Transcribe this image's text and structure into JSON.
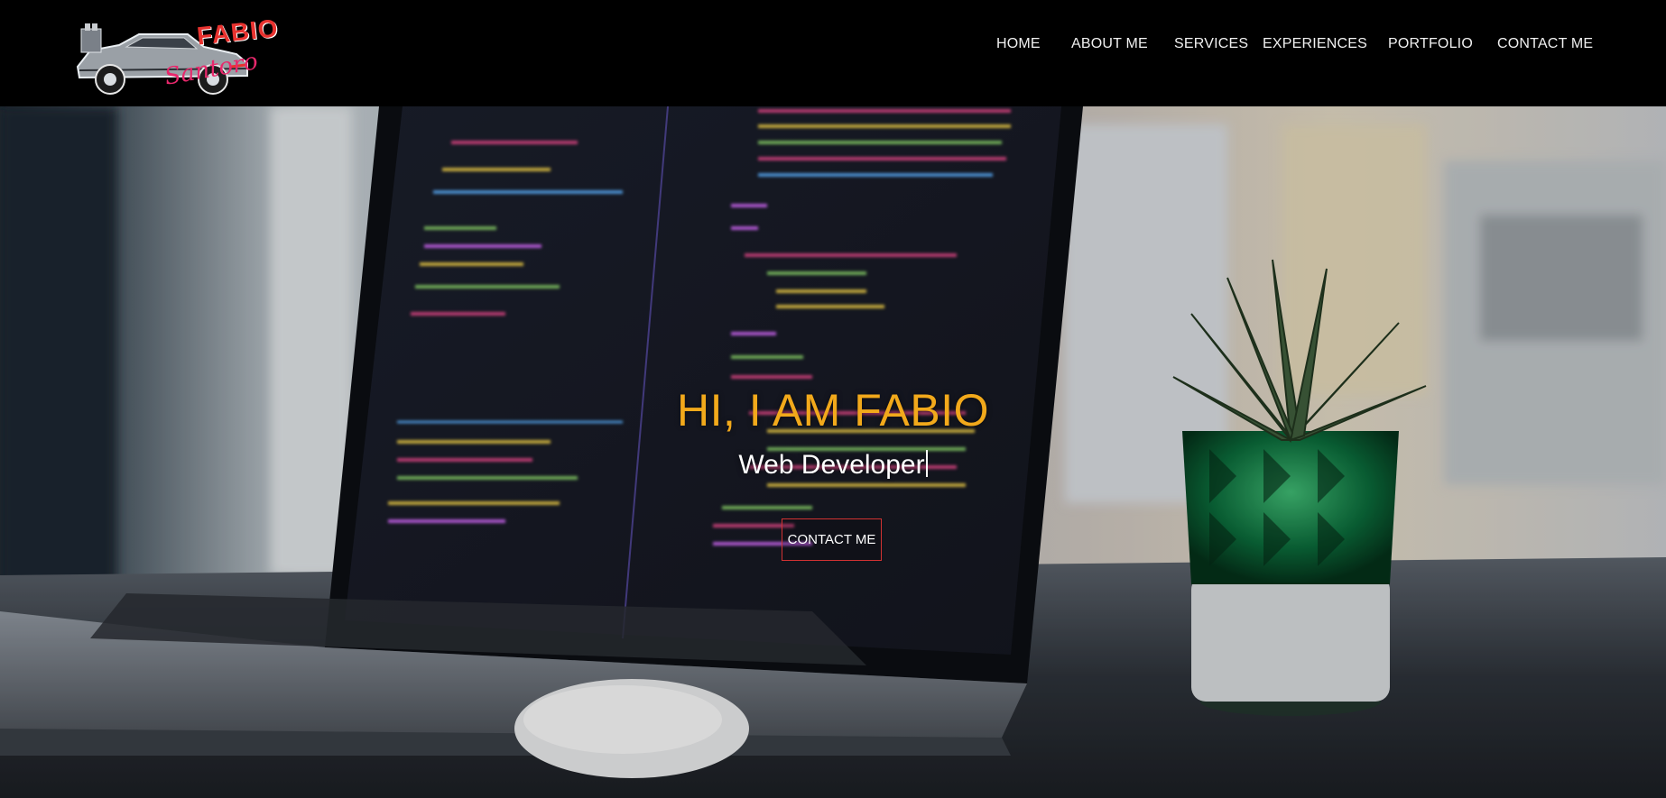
{
  "brand": {
    "logo_text": "FABIO",
    "logo_script": "Santoro"
  },
  "nav": {
    "items": [
      {
        "label": "HOME"
      },
      {
        "label": "ABOUT ME"
      },
      {
        "label": "SERVICES"
      },
      {
        "label": "EXPERIENCES"
      },
      {
        "label": "PORTFOLIO"
      },
      {
        "label": "CONTACT ME"
      }
    ]
  },
  "hero": {
    "title": "HI, I AM FABIO",
    "subtitle": "Web Developer",
    "cta_label": "CONTACT ME"
  },
  "colors": {
    "nav_background": "#000000",
    "nav_text": "#f0f0f0",
    "title_accent": "#f2a91b",
    "button_border": "#d23232",
    "logo_red": "#e8322f"
  }
}
